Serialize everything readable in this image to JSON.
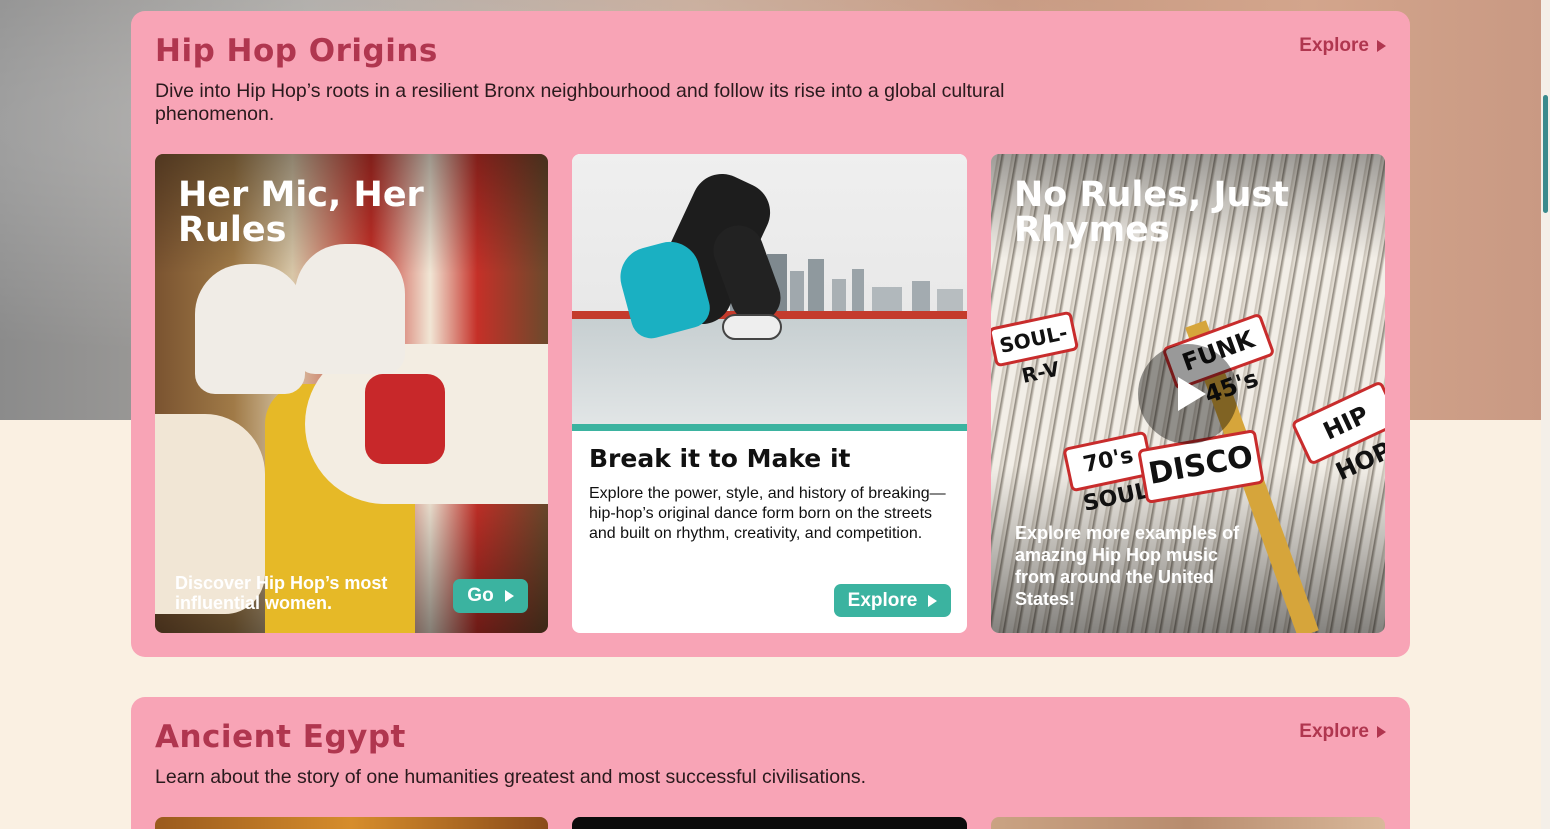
{
  "sections": [
    {
      "title": "Hip Hop Origins",
      "description": "Dive into Hip Hop’s roots in a resilient Bronx neighbourhood and follow its rise into a global cultural phenomenon.",
      "explore_label": "Explore",
      "cards": [
        {
          "title": "Her Mic, Her Rules",
          "caption": "Discover Hip Hop’s most influential women.",
          "button_label": "Go"
        },
        {
          "title": "Break it to Make it",
          "description": "Explore the power, style, and history of breaking—hip-hop’s original dance form born on the streets and built on rhythm, creativity, and competition.",
          "button_label": "Explore"
        },
        {
          "title": "No Rules, Just Rhymes",
          "caption": "Explore more examples of amazing Hip Hop music from around the United States!",
          "record_tabs": [
            "DISCO",
            "FUNK 45's",
            "HIP HOP",
            "70's SOUL",
            "SOUL-R-V"
          ]
        }
      ]
    },
    {
      "title": "Ancient Egypt",
      "description": "Learn about the story of one humanities greatest and most successful civilisations.",
      "explore_label": "Explore"
    }
  ],
  "colors": {
    "page_background": "#faf0e2",
    "section_background": "#f8a4b6",
    "section_title": "#b0364f",
    "accent_teal": "#3bb3a0"
  },
  "icons": {
    "explore_arrow": "triangle-right-icon",
    "play": "play-icon"
  }
}
